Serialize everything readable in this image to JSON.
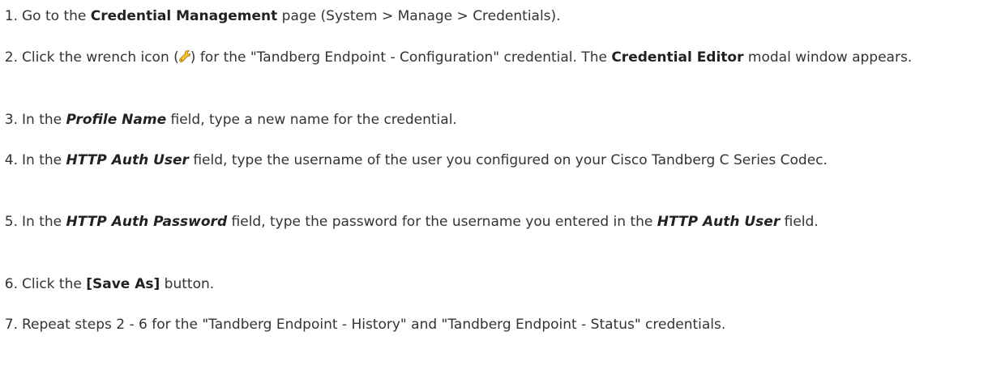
{
  "steps": [
    {
      "number": "1.",
      "pre": "Go to the ",
      "strong": "Credential Management",
      "post": " page (System > Manage > Credentials)."
    },
    {
      "number": "2.",
      "pre": "Click the wrench icon (",
      "icon": "wrench-icon",
      "mid": ") for the \"Tandberg Endpoint - Configuration\" credential. The ",
      "strong": "Credential Editor",
      "post": " modal window appears."
    },
    {
      "number": "3.",
      "pre": "In the ",
      "field": "Profile Name",
      "post": " field, type a new name for the credential."
    },
    {
      "number": "4.",
      "pre": "In the ",
      "field": "HTTP Auth User",
      "post": " field, type the username of the user you configured on your Cisco Tandberg C Series Codec."
    },
    {
      "number": "5.",
      "pre": "In the ",
      "field": "HTTP Auth Password",
      "mid": " field, type the password for the username you entered in the ",
      "field2": "HTTP Auth User",
      "post": " field."
    },
    {
      "number": "6.",
      "pre": "Click the ",
      "strong": "[Save As]",
      "post": " button."
    },
    {
      "number": "7.",
      "pre": "Repeat steps 2 - 6 for the \"Tandberg Endpoint - History\" and \"Tandberg Endpoint - Status\" credentials."
    }
  ],
  "colors": {
    "text": "#333333",
    "wrench_yellow": "#f2c230"
  }
}
